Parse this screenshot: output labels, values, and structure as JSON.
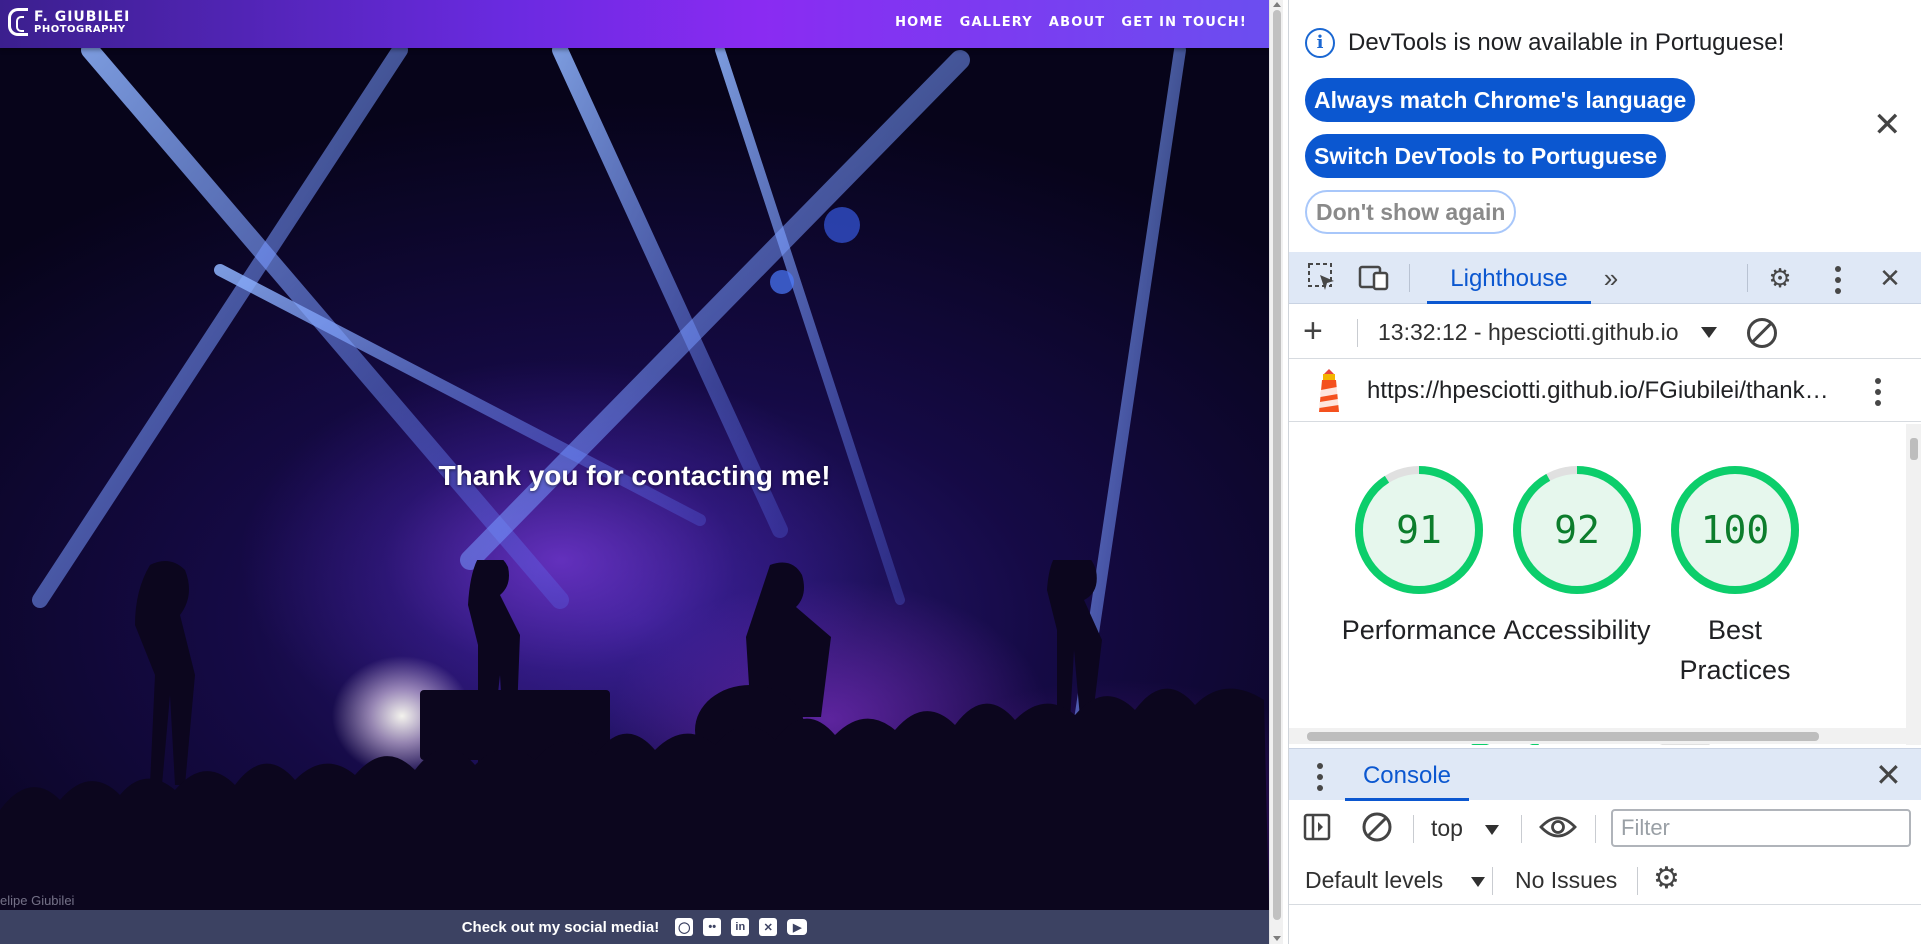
{
  "site": {
    "logo": {
      "line1": "F. GIUBILEI",
      "line2": "PHOTOGRAPHY"
    },
    "nav": [
      "HOME",
      "GALLERY",
      "ABOUT",
      "GET IN TOUCH!"
    ],
    "heading": "Thank you for contacting me!",
    "watermark": "elipe Giubilei",
    "footer": {
      "text": "Check out my social media!",
      "icons": [
        "instagram-icon",
        "flickr-icon",
        "linkedin-icon",
        "x-icon",
        "youtube-icon"
      ]
    },
    "colors": {
      "navbar": "#6a2ae0",
      "footer": "#3c4262"
    }
  },
  "devtools": {
    "infobar": {
      "message": "DevTools is now available in Portuguese!",
      "buttons": [
        "Always match Chrome's language",
        "Switch DevTools to Portuguese",
        "Don't show again"
      ]
    },
    "panel_tab": "Lighthouse",
    "report_selector": "13:32:12 - hpesciotti.github.io",
    "report_url": "https://hpesciotti.github.io/FGiubilei/thank…",
    "scores": [
      {
        "value": 91,
        "label_line1": "Performance",
        "label_line2": ""
      },
      {
        "value": 92,
        "label_line1": "Accessibility",
        "label_line2": ""
      },
      {
        "value": 100,
        "label_line1": "Best",
        "label_line2": "Practices"
      }
    ],
    "score_colors": {
      "pass": "#0cce6b",
      "pass_fill": "#e6f7ed",
      "pass_text": "#0c7d2c"
    },
    "drawer_tab": "Console",
    "console": {
      "context": "top",
      "filter_placeholder": "Filter",
      "levels": "Default levels",
      "issues": "No Issues"
    },
    "accent": "#0b57d0"
  }
}
